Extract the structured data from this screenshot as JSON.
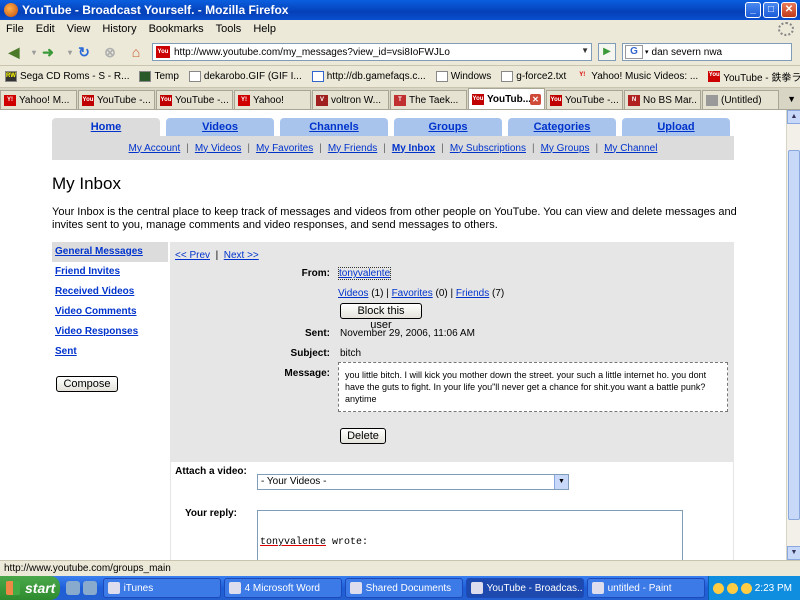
{
  "window": {
    "title": "YouTube - Broadcast Yourself. - Mozilla Firefox"
  },
  "menu": [
    "File",
    "Edit",
    "View",
    "History",
    "Bookmarks",
    "Tools",
    "Help"
  ],
  "nav": {
    "url": "http://www.youtube.com/my_messages?view_id=vsi8IoFWJLo",
    "url_favicon": "You",
    "search_value": "dan severn nwa"
  },
  "bookmarks": [
    {
      "label": "Sega CD Roms - S - R...",
      "icon": "RW"
    },
    {
      "label": "Temp",
      "icon": ""
    },
    {
      "label": "dekarobo.GIF (GIF I...",
      "icon": ""
    },
    {
      "label": "http://db.gamefaqs.c...",
      "icon": ""
    },
    {
      "label": "Windows",
      "icon": ""
    },
    {
      "label": "g-force2.txt",
      "icon": ""
    },
    {
      "label": "Yahoo! Music Videos: ...",
      "icon": "Y!"
    },
    {
      "label": "YouTube - 鉄拳ライガ...",
      "icon": "You"
    }
  ],
  "tabs": [
    {
      "label": "Yahoo! M...",
      "icon": "Y!",
      "color": "#d00000"
    },
    {
      "label": "YouTube -...",
      "icon": "You",
      "color": "#c00000"
    },
    {
      "label": "YouTube -...",
      "icon": "You",
      "color": "#c00000"
    },
    {
      "label": "Yahoo!",
      "icon": "Y!",
      "color": "#d00000"
    },
    {
      "label": "voltron W...",
      "icon": "V",
      "color": "#a02020"
    },
    {
      "label": "The Taek...",
      "icon": "T",
      "color": "#c03030"
    },
    {
      "label": "YouTub...",
      "icon": "You",
      "color": "#c00000",
      "active": true
    },
    {
      "label": "YouTube -...",
      "icon": "You",
      "color": "#c00000"
    },
    {
      "label": "No BS Mar...",
      "icon": "N",
      "color": "#b02020"
    },
    {
      "label": "(Untitled)",
      "icon": "",
      "color": "#999999"
    }
  ],
  "yt": {
    "main_tabs": [
      "Home",
      "Videos",
      "Channels",
      "Groups",
      "Categories",
      "Upload"
    ],
    "sub_nav": [
      "My Account",
      "My Videos",
      "My Favorites",
      "My Friends",
      "My Inbox",
      "My Subscriptions",
      "My Groups",
      "My Channel"
    ],
    "active_sub": "My Inbox",
    "page_title": "My Inbox",
    "intro": "Your Inbox is the central place to keep track of messages and videos from other people on YouTube. You can view and delete messages and invites sent to you, manage comments and video responses, and send messages to others.",
    "left_nav": [
      "General Messages",
      "Friend Invites",
      "Received Videos",
      "Video Comments",
      "Video Responses",
      "Sent"
    ],
    "compose_label": "Compose"
  },
  "message": {
    "prev": "<< Prev",
    "next": "Next >>",
    "from_label": "From:",
    "from_user": "tonyvalente",
    "videos_link": "Videos",
    "videos_count": "(1)",
    "favorites_link": "Favorites",
    "favorites_count": "(0)",
    "friends_link": "Friends",
    "friends_count": "(7)",
    "block_label": "Block this user",
    "sent_label": "Sent:",
    "sent_value": "November 29, 2006, 11:06 AM",
    "subject_label": "Subject:",
    "subject_value": "bitch",
    "message_label": "Message:",
    "message_value": "you little bitch. I will kick you mother down the street. your such a little internet ho. you dont have the guts to fight. In your life you\"ll never get a chance for shit.you want a battle punk? anytime",
    "delete_label": "Delete"
  },
  "reply": {
    "attach_label": "Attach a video:",
    "select_value": "- Your Videos -",
    "reply_label": "Your reply:",
    "reply_user": "tonyvalente",
    "reply_suffix": " wrote:"
  },
  "status": "http://www.youtube.com/groups_main",
  "taskbar": {
    "start_label": "start",
    "tasks": [
      {
        "label": "iTunes",
        "active": false
      },
      {
        "label": "4 Microsoft Word",
        "active": false
      },
      {
        "label": "Shared Documents",
        "active": false
      },
      {
        "label": "YouTube - Broadcas...",
        "active": true
      },
      {
        "label": "untitled - Paint",
        "active": false
      }
    ],
    "clock": "2:23 PM"
  }
}
